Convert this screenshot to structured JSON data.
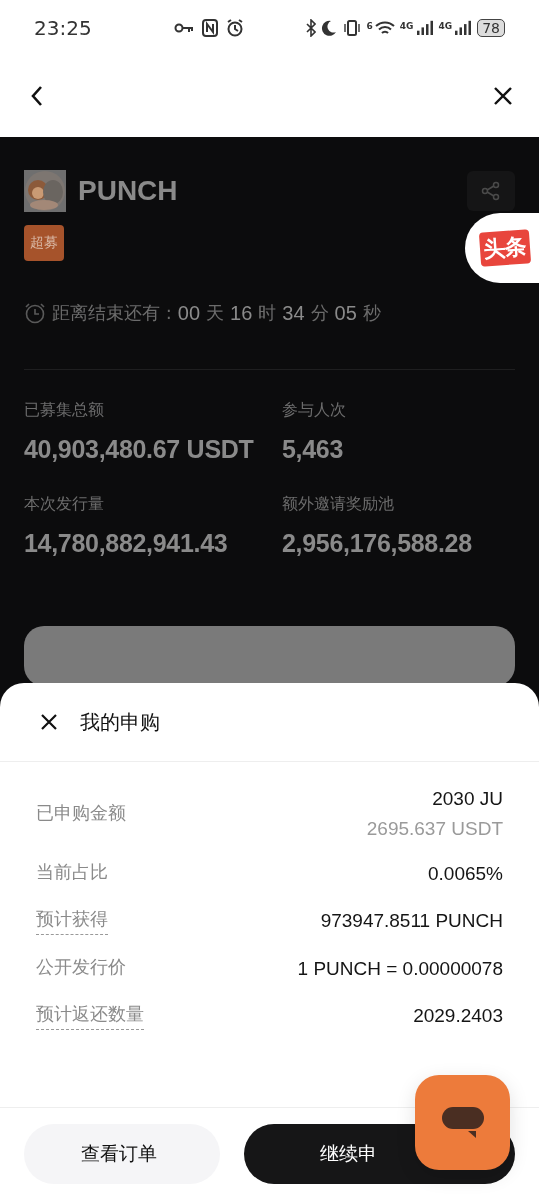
{
  "status_bar": {
    "time": "23:25",
    "wifi_tag": "6",
    "network_tags": [
      "4G",
      "4G"
    ],
    "battery": "78"
  },
  "project": {
    "name": "PUNCH",
    "tag": "超募",
    "badge": "头条",
    "countdown_label": "距离结束还有 :",
    "countdown": [
      {
        "value": "00",
        "unit": "天"
      },
      {
        "value": "16",
        "unit": "时"
      },
      {
        "value": "34",
        "unit": "分"
      },
      {
        "value": "05",
        "unit": "秒"
      }
    ],
    "stats": [
      {
        "label": "已募集总额",
        "value": "40,903,480.67 USDT"
      },
      {
        "label": "参与人次",
        "value": "5,463"
      },
      {
        "label": "本次发行量",
        "value": "14,780,882,941.43"
      },
      {
        "label": "额外邀请奖励池",
        "value": "2,956,176,588.28"
      }
    ]
  },
  "sheet": {
    "title": "我的申购",
    "rows": [
      {
        "label": "已申购金额",
        "underlined": false,
        "values": [
          "2030 JU",
          "2695.637 USDT"
        ]
      },
      {
        "label": "当前占比",
        "underlined": false,
        "values": [
          "0.0065%"
        ]
      },
      {
        "label": "预计获得",
        "underlined": true,
        "values": [
          "973947.8511 PUNCH"
        ]
      },
      {
        "label": "公开发行价",
        "underlined": false,
        "values": [
          "1 PUNCH = 0.00000078"
        ]
      },
      {
        "label": "预计返还数量",
        "underlined": true,
        "values": [
          "2029.2403"
        ]
      }
    ],
    "buttons": [
      {
        "label": "查看订单",
        "kind": "secondary"
      },
      {
        "label": "继续申",
        "kind": "primary"
      }
    ]
  }
}
